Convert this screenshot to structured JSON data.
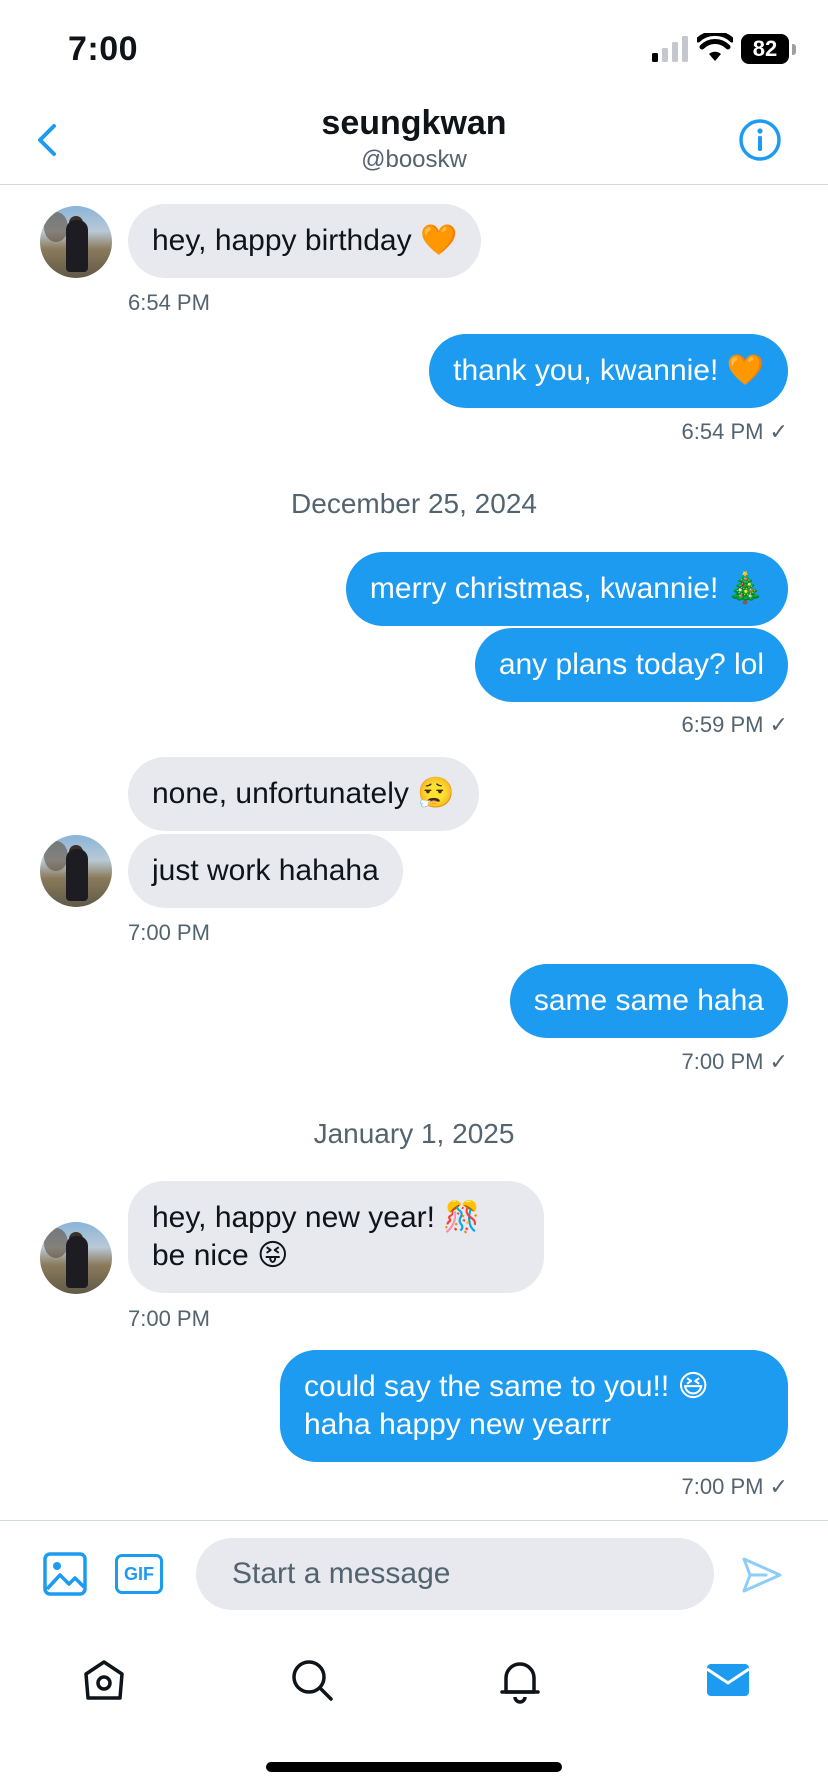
{
  "status_bar": {
    "time": "7:00",
    "battery": "82"
  },
  "header": {
    "name": "seungkwan",
    "handle": "@booskw"
  },
  "messages": [
    {
      "text": "hey, happy birthday 🧡",
      "time": "6:54 PM"
    },
    {
      "text": "thank you, kwannie! 🧡",
      "time": "6:54 PM ✓"
    },
    {
      "date": "December 25, 2024"
    },
    {
      "text": "merry christmas, kwannie! 🎄"
    },
    {
      "text": "any plans today? lol",
      "time": "6:59 PM ✓"
    },
    {
      "text": "none, unfortunately 😮‍💨"
    },
    {
      "text": "just work hahaha",
      "time": "7:00 PM"
    },
    {
      "text": "same same haha",
      "time": "7:00 PM ✓"
    },
    {
      "date": "January 1, 2025"
    },
    {
      "line1": "hey, happy new year! 🎊",
      "line2": "be nice 😝",
      "time": "7:00 PM"
    },
    {
      "line1": "could say the same to you!! 😆",
      "line2": "haha happy new yearrr",
      "time": "7:00 PM ✓"
    }
  ],
  "composer": {
    "placeholder": "Start a message",
    "gif_label": "GIF"
  },
  "tabs": [
    "home-icon",
    "search-icon",
    "bell-icon",
    "mail-icon"
  ],
  "colors": {
    "accent": "#1d9bf0",
    "incoming_bubble": "#e7e9ef"
  }
}
